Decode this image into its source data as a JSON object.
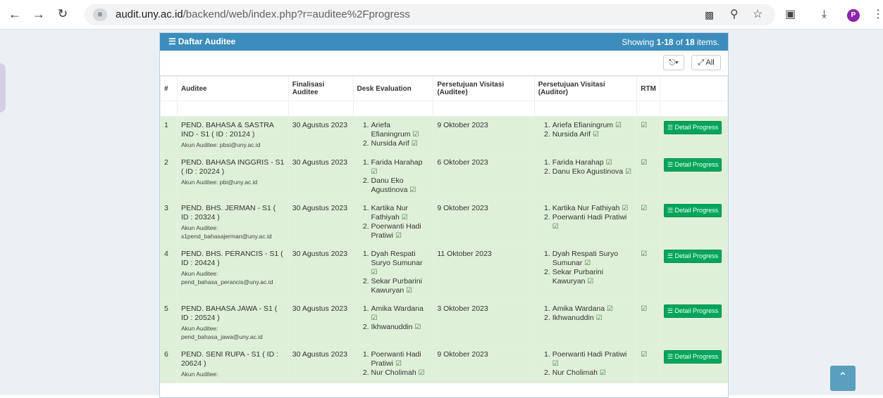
{
  "browser": {
    "url_host": "audit.uny.ac.id",
    "url_path": "/backend/web/index.php?r=auditee%2Fprogress",
    "avatar_letter": "P"
  },
  "panel": {
    "title": "Daftar Auditee",
    "summary_prefix": "Showing ",
    "summary_range": "1-18",
    "summary_mid": " of ",
    "summary_total": "18",
    "summary_suffix": " items.",
    "all_button": "All"
  },
  "table": {
    "headers": [
      "#",
      "Auditee",
      "Finalisasi Auditee",
      "Desk Evaluation",
      "Persetujuan Visitasi (Auditee)",
      "Persetujuan Visitasi (Auditor)",
      "RTM",
      ""
    ],
    "detail_label": "Detail Progress",
    "account_prefix": "Akun Auditee:",
    "rows": [
      {
        "no": "1",
        "auditee": "PEND. BAHASA & SASTRA IND - S1 ( ID : 20124 )",
        "account": "pbsi@uny.ac.id",
        "finalisasi": "30 Agustus 2023",
        "desk": [
          "Ariefa Efianingrum",
          "Nursida Arif"
        ],
        "visit_auditee": "9 Oktober 2023",
        "visit_auditor": [
          "Ariefa Efianingrum",
          "Nursida Arif"
        ]
      },
      {
        "no": "2",
        "auditee": "PEND. BAHASA INGGRIS - S1 ( ID : 20224 )",
        "account": "pbi@uny.ac.id",
        "finalisasi": "30 Agustus 2023",
        "desk": [
          "Farida Harahap",
          "Danu Eko Agustinova"
        ],
        "visit_auditee": "6 Oktober 2023",
        "visit_auditor": [
          "Farida Harahap",
          "Danu Eko Agustinova"
        ]
      },
      {
        "no": "3",
        "auditee": "PEND. BHS. JERMAN - S1 ( ID : 20324 )",
        "account": "s1pend_bahasajerman@uny.ac.id",
        "finalisasi": "30 Agustus 2023",
        "desk": [
          "Kartika Nur Fathiyah",
          "Poerwanti Hadi Pratiwi"
        ],
        "visit_auditee": "9 Oktober 2023",
        "visit_auditor": [
          "Kartika Nur Fathiyah",
          "Poerwanti Hadi Pratiwi"
        ]
      },
      {
        "no": "4",
        "auditee": "PEND. BHS. PERANCIS - S1 ( ID : 20424 )",
        "account": "pend_bahasa_perancis@uny.ac.id",
        "finalisasi": "30 Agustus 2023",
        "desk": [
          "Dyah Respati Suryo Sumunar",
          "Sekar Purbarini Kawuryan"
        ],
        "visit_auditee": "11 Oktober 2023",
        "visit_auditor": [
          "Dyah Respati Suryo Sumunar",
          "Sekar Purbarini Kawuryan"
        ]
      },
      {
        "no": "5",
        "auditee": "PEND. BAHASA JAWA - S1 ( ID : 20524 )",
        "account": "pend_bahasa_jawa@uny.ac.id",
        "finalisasi": "30 Agustus 2023",
        "desk": [
          "Amika Wardana",
          "Ikhwanuddin"
        ],
        "visit_auditee": "3 Oktober 2023",
        "visit_auditor": [
          "Amika Wardana",
          "Ikhwanuddin"
        ]
      },
      {
        "no": "6",
        "auditee": "PEND. SENI RUPA - S1 ( ID : 20624 )",
        "account": "",
        "finalisasi": "30 Agustus 2023",
        "desk": [
          "Poerwanti Hadi Pratiwi",
          "Nur Cholimah"
        ],
        "visit_auditee": "9 Oktober 2023",
        "visit_auditor": [
          "Poerwanti Hadi Pratiwi",
          "Nur Cholimah"
        ]
      }
    ]
  }
}
